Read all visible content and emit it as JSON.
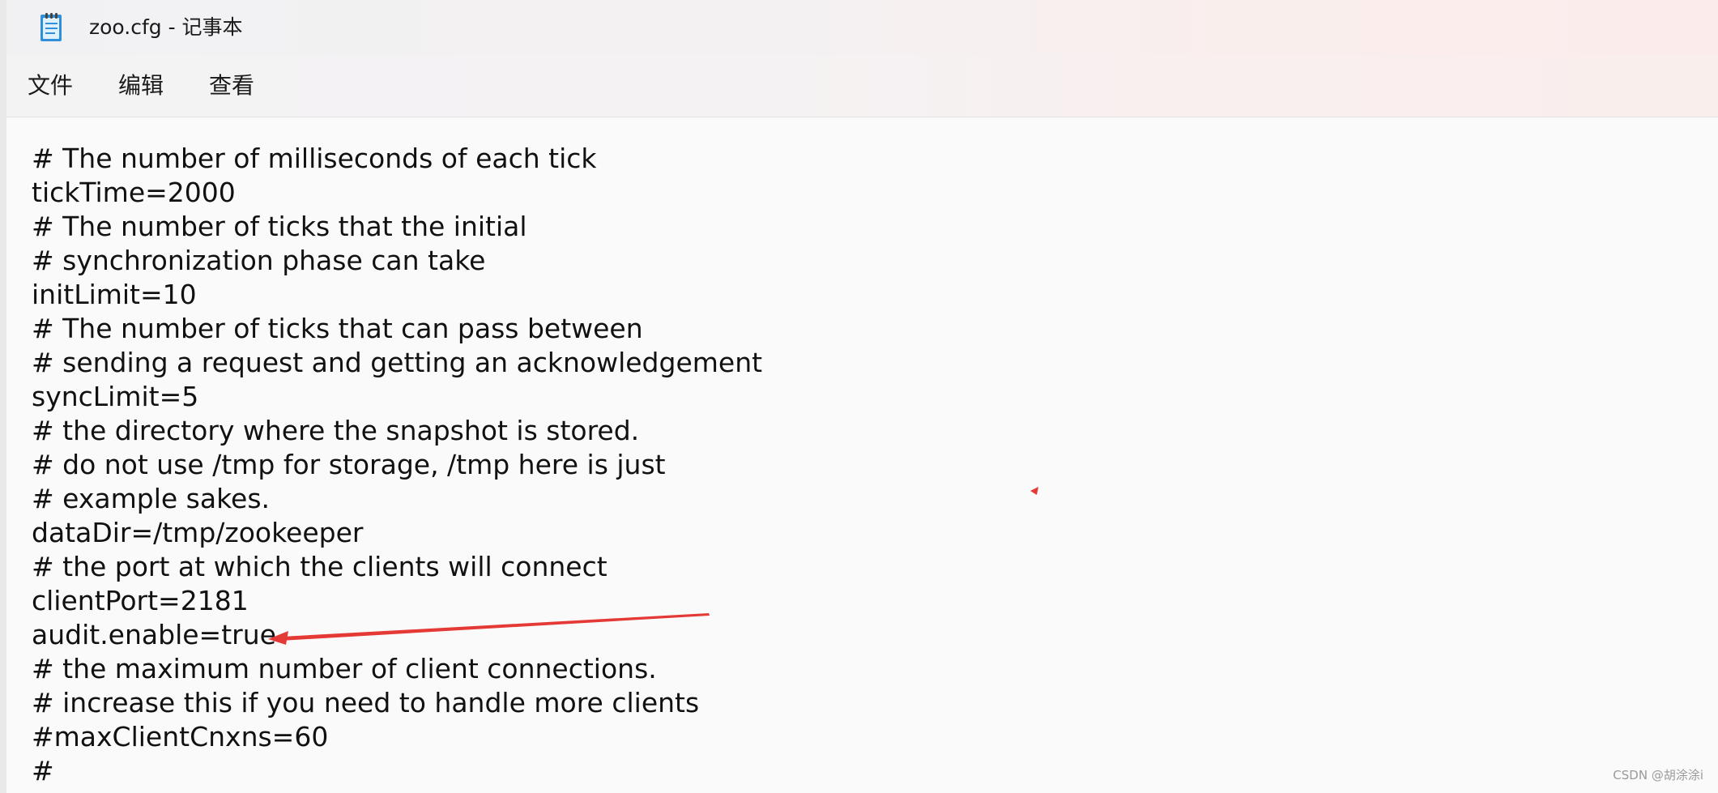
{
  "window": {
    "title": "zoo.cfg - 记事本",
    "app_icon": "notepad-icon"
  },
  "menu": {
    "file": "文件",
    "edit": "编辑",
    "view": "查看"
  },
  "editor": {
    "lines": [
      "# The number of milliseconds of each tick",
      "tickTime=2000",
      "# The number of ticks that the initial",
      "# synchronization phase can take",
      "initLimit=10",
      "# The number of ticks that can pass between",
      "# sending a request and getting an acknowledgement",
      "syncLimit=5",
      "# the directory where the snapshot is stored.",
      "# do not use /tmp for storage, /tmp here is just",
      "# example sakes.",
      "dataDir=/tmp/zookeeper",
      "# the port at which the clients will connect",
      "clientPort=2181",
      "audit.enable=true",
      "# the maximum number of client connections.",
      "# increase this if you need to handle more clients",
      "#maxClientCnxns=60",
      "#"
    ]
  },
  "annotation": {
    "arrow_color": "#e53935",
    "points_to": "audit.enable=true"
  },
  "watermark": "CSDN @胡涂涂i"
}
